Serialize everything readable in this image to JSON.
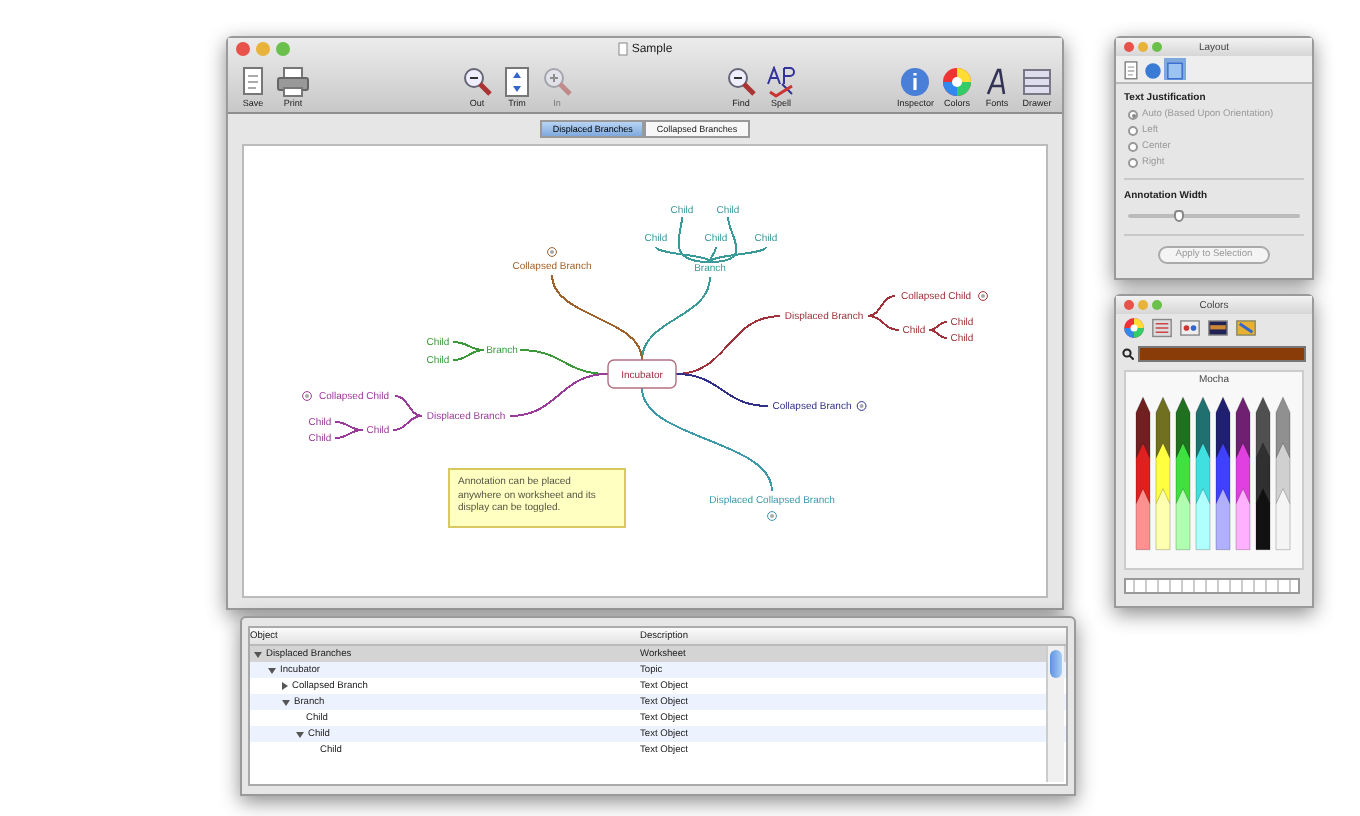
{
  "main_window": {
    "title": "Sample",
    "toolbar": [
      [
        {
          "label": "Save",
          "disabled": false
        },
        {
          "label": "Print",
          "disabled": false
        }
      ],
      [
        {
          "label": "Out",
          "disabled": false
        },
        {
          "label": "Trim",
          "disabled": false
        },
        {
          "label": "In",
          "disabled": true
        }
      ],
      [
        {
          "label": "Find",
          "disabled": false
        },
        {
          "label": "Spell",
          "disabled": false
        }
      ],
      [
        {
          "label": "Inspector",
          "disabled": false
        },
        {
          "label": "Colors",
          "disabled": false
        },
        {
          "label": "Fonts",
          "disabled": false
        },
        {
          "label": "Drawer",
          "disabled": false
        }
      ]
    ],
    "tabs": [
      {
        "label": "Displaced Branches",
        "selected": true
      },
      {
        "label": "Collapsed Branches",
        "selected": false
      }
    ],
    "mind_map": {
      "topic": "Incubator",
      "nodes": [
        {
          "text": "Child",
          "color": "#3a9a9a",
          "collapsed": false
        },
        {
          "text": "Child",
          "color": "#3a9a9a",
          "collapsed": false
        },
        {
          "text": "Child",
          "color": "#3a9a9a",
          "collapsed": false
        },
        {
          "text": "Child",
          "color": "#3a9a9a",
          "collapsed": false
        },
        {
          "text": "Child",
          "color": "#3a9a9a",
          "collapsed": false
        },
        {
          "text": "Branch",
          "color": "#3a9a9a",
          "collapsed": false
        },
        {
          "text": "Collapsed Branch",
          "color": "#a0602a",
          "collapsed": true
        },
        {
          "text": "Child",
          "color": "#3a9a3a",
          "collapsed": false
        },
        {
          "text": "Child",
          "color": "#3a9a3a",
          "collapsed": false
        },
        {
          "text": "Branch",
          "color": "#3a9a3a",
          "collapsed": false
        },
        {
          "text": "Collapsed Child",
          "color": "#9a3a9a",
          "collapsed": true
        },
        {
          "text": "Child",
          "color": "#9a3a9a",
          "collapsed": false
        },
        {
          "text": "Child",
          "color": "#9a3a9a",
          "collapsed": false
        },
        {
          "text": "Child",
          "color": "#9a3a9a",
          "collapsed": false
        },
        {
          "text": "Displaced Branch",
          "color": "#9a3a9a",
          "collapsed": false
        },
        {
          "text": "Displaced Branch",
          "color": "#a0303a",
          "collapsed": false
        },
        {
          "text": "Collapsed Child",
          "color": "#a0303a",
          "collapsed": true
        },
        {
          "text": "Child",
          "color": "#a0303a",
          "collapsed": false
        },
        {
          "text": "Child",
          "color": "#a0303a",
          "collapsed": false
        },
        {
          "text": "Child",
          "color": "#a0303a",
          "collapsed": false
        },
        {
          "text": "Collapsed Branch",
          "color": "#30308a",
          "collapsed": true
        },
        {
          "text": "Displaced Collapsed Branch",
          "color": "#3a9aaa",
          "collapsed": true
        }
      ],
      "annotation": "Annotation can be placed anywhere on worksheet and its display can be toggled."
    }
  },
  "outline_window": {
    "columns": [
      "Object",
      "Description"
    ],
    "rows": [
      {
        "object": "Displaced Branches",
        "description": "Worksheet",
        "selected": true,
        "expanded": true,
        "children": [
          {
            "object": "Incubator",
            "description": "Topic",
            "selected": false,
            "expanded": true,
            "children": [
              {
                "object": "Collapsed Branch",
                "description": "Text Object",
                "selected": false,
                "expanded": false
              },
              {
                "object": "Branch",
                "description": "Text Object",
                "selected": false,
                "expanded": true,
                "children": [
                  {
                    "object": "Child",
                    "description": "Text Object",
                    "selected": false
                  },
                  {
                    "object": "Child",
                    "description": "Text Object",
                    "selected": false,
                    "expanded": true,
                    "children": [
                      {
                        "object": "Child",
                        "description": "Text Object",
                        "selected": false
                      }
                    ]
                  }
                ]
              }
            ]
          }
        ]
      }
    ]
  },
  "layout_panel": {
    "title": "Layout",
    "tabs": [
      {
        "selected": false
      },
      {
        "selected": false
      },
      {
        "selected": true
      }
    ],
    "justification_label": "Text Justification",
    "options": [
      {
        "label": "Auto (Based Upon Orientation)",
        "selected": true,
        "disabled": true
      },
      {
        "label": "Left",
        "selected": false,
        "disabled": true
      },
      {
        "label": "Center",
        "selected": false,
        "disabled": true
      },
      {
        "label": "Right",
        "selected": false,
        "disabled": true
      }
    ],
    "width_label": "Annotation Width",
    "width": {
      "level": 0.3
    },
    "apply_button": {
      "label": "Apply to Selection",
      "disabled": true
    }
  },
  "colors_panel": {
    "title": "Colors",
    "swatch": {
      "color": "#8a3c08"
    },
    "palette_name": "Mocha"
  }
}
